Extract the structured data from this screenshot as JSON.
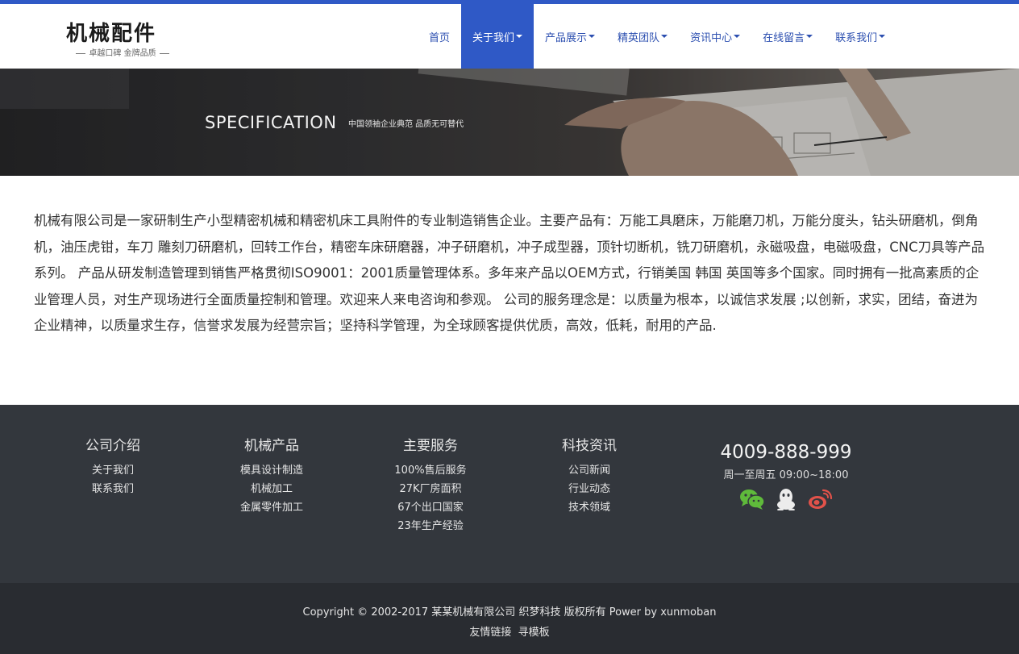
{
  "header": {
    "logo_title": "机械配件",
    "logo_subtitle": "卓越口碑 金牌品质",
    "nav": [
      {
        "label": "首页",
        "active": false,
        "dropdown": false
      },
      {
        "label": "关于我们",
        "active": true,
        "dropdown": true
      },
      {
        "label": "产品展示",
        "active": false,
        "dropdown": true
      },
      {
        "label": "精英团队",
        "active": false,
        "dropdown": true
      },
      {
        "label": "资讯中心",
        "active": false,
        "dropdown": true
      },
      {
        "label": "在线留言",
        "active": false,
        "dropdown": true
      },
      {
        "label": "联系我们",
        "active": false,
        "dropdown": true
      }
    ]
  },
  "banner": {
    "title": "SPECIFICATION",
    "subtitle": "中国领袖企业典范  品质无可替代"
  },
  "content": {
    "paragraph": " 机械有限公司是一家研制生产小型精密机械和精密机床工具附件的专业制造销售企业。主要产品有：万能工具磨床，万能磨刀机，万能分度头，钻头研磨机，倒角机，油压虎钳，车刀 雕刻刀研磨机，回转工作台，精密车床研磨器，冲子研磨机，冲子成型器，顶针切断机，铣刀研磨机，永磁吸盘，电磁吸盘，CNC刀具等产品系列。 产品从研发制造管理到销售严格贯彻ISO9001：2001质量管理体系。多年来产品以OEM方式，行销美国 韩国 英国等多个国家。同时拥有一批高素质的企业管理人员，对生产现场进行全面质量控制和管理。欢迎来人来电咨询和参观。 公司的服务理念是：以质量为根本，以诚信求发展 ;以创新，求实，团结，奋进为企业精神，以质量求生存，信誉求发展为经营宗旨；坚持科学管理，为全球顾客提供优质，高效，低耗，耐用的产品."
  },
  "footer": {
    "columns": [
      {
        "title": "公司介绍",
        "links": [
          "关于我们",
          "联系我们"
        ]
      },
      {
        "title": "机械产品",
        "links": [
          "模具设计制造",
          "机械加工",
          "金属零件加工"
        ]
      },
      {
        "title": "主要服务",
        "links": [
          "100%售后服务",
          "27K厂房面积",
          "67个出口国家",
          "23年生产经验"
        ]
      },
      {
        "title": "科技资讯",
        "links": [
          "公司新闻",
          "行业动态",
          "技术领域"
        ]
      }
    ],
    "phone": "4009-888-999",
    "hours": "周一至周五 09:00~18:00",
    "socials": [
      "wechat-icon",
      "qq-icon",
      "weibo-icon"
    ],
    "copyright": "Copyright © 2002-2017 某某机械有限公司 织梦科技 版权所有 Power by xunmoban",
    "friend_links_label": "友情链接",
    "friend_links": [
      "寻模板"
    ]
  },
  "colors": {
    "accent": "#2f59c6",
    "nav_text": "#2c4fb0",
    "footer_bg": "#33373d",
    "copyright_bg": "#292c31",
    "wechat": "#5fba3b",
    "weibo": "#e2524a"
  }
}
